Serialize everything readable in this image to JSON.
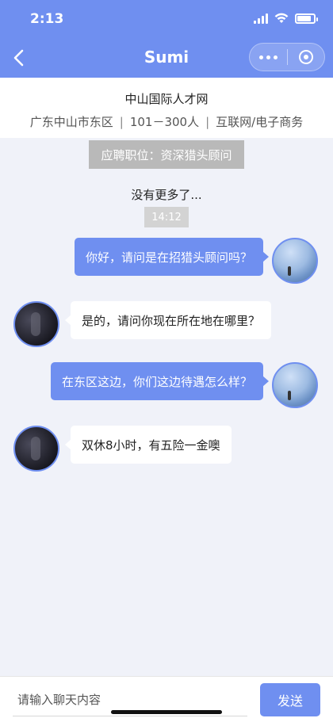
{
  "status": {
    "time": "2:13"
  },
  "nav": {
    "title": "Sumi"
  },
  "company": {
    "name": "中山国际人才网",
    "location": "广东中山市东区",
    "size": "101－300人",
    "industry": "互联网/电子商务",
    "separator": "|"
  },
  "position_tag": "应聘职位：资深猎头顾问",
  "no_more": "没有更多了...",
  "timestamp": "14:12",
  "messages": [
    {
      "from": "me",
      "text": "你好，请问是在招猎头顾问吗？"
    },
    {
      "from": "them",
      "text": "是的，请问你现在所在地在哪里？"
    },
    {
      "from": "me",
      "text": "在东区这边，你们这边待遇怎么样？"
    },
    {
      "from": "them",
      "text": "双休8小时，有五险一金噢"
    }
  ],
  "input": {
    "placeholder": "请输入聊天内容",
    "value": ""
  },
  "send_label": "发送",
  "colors": {
    "accent": "#6f8ff0",
    "background": "#f0f2f9"
  }
}
